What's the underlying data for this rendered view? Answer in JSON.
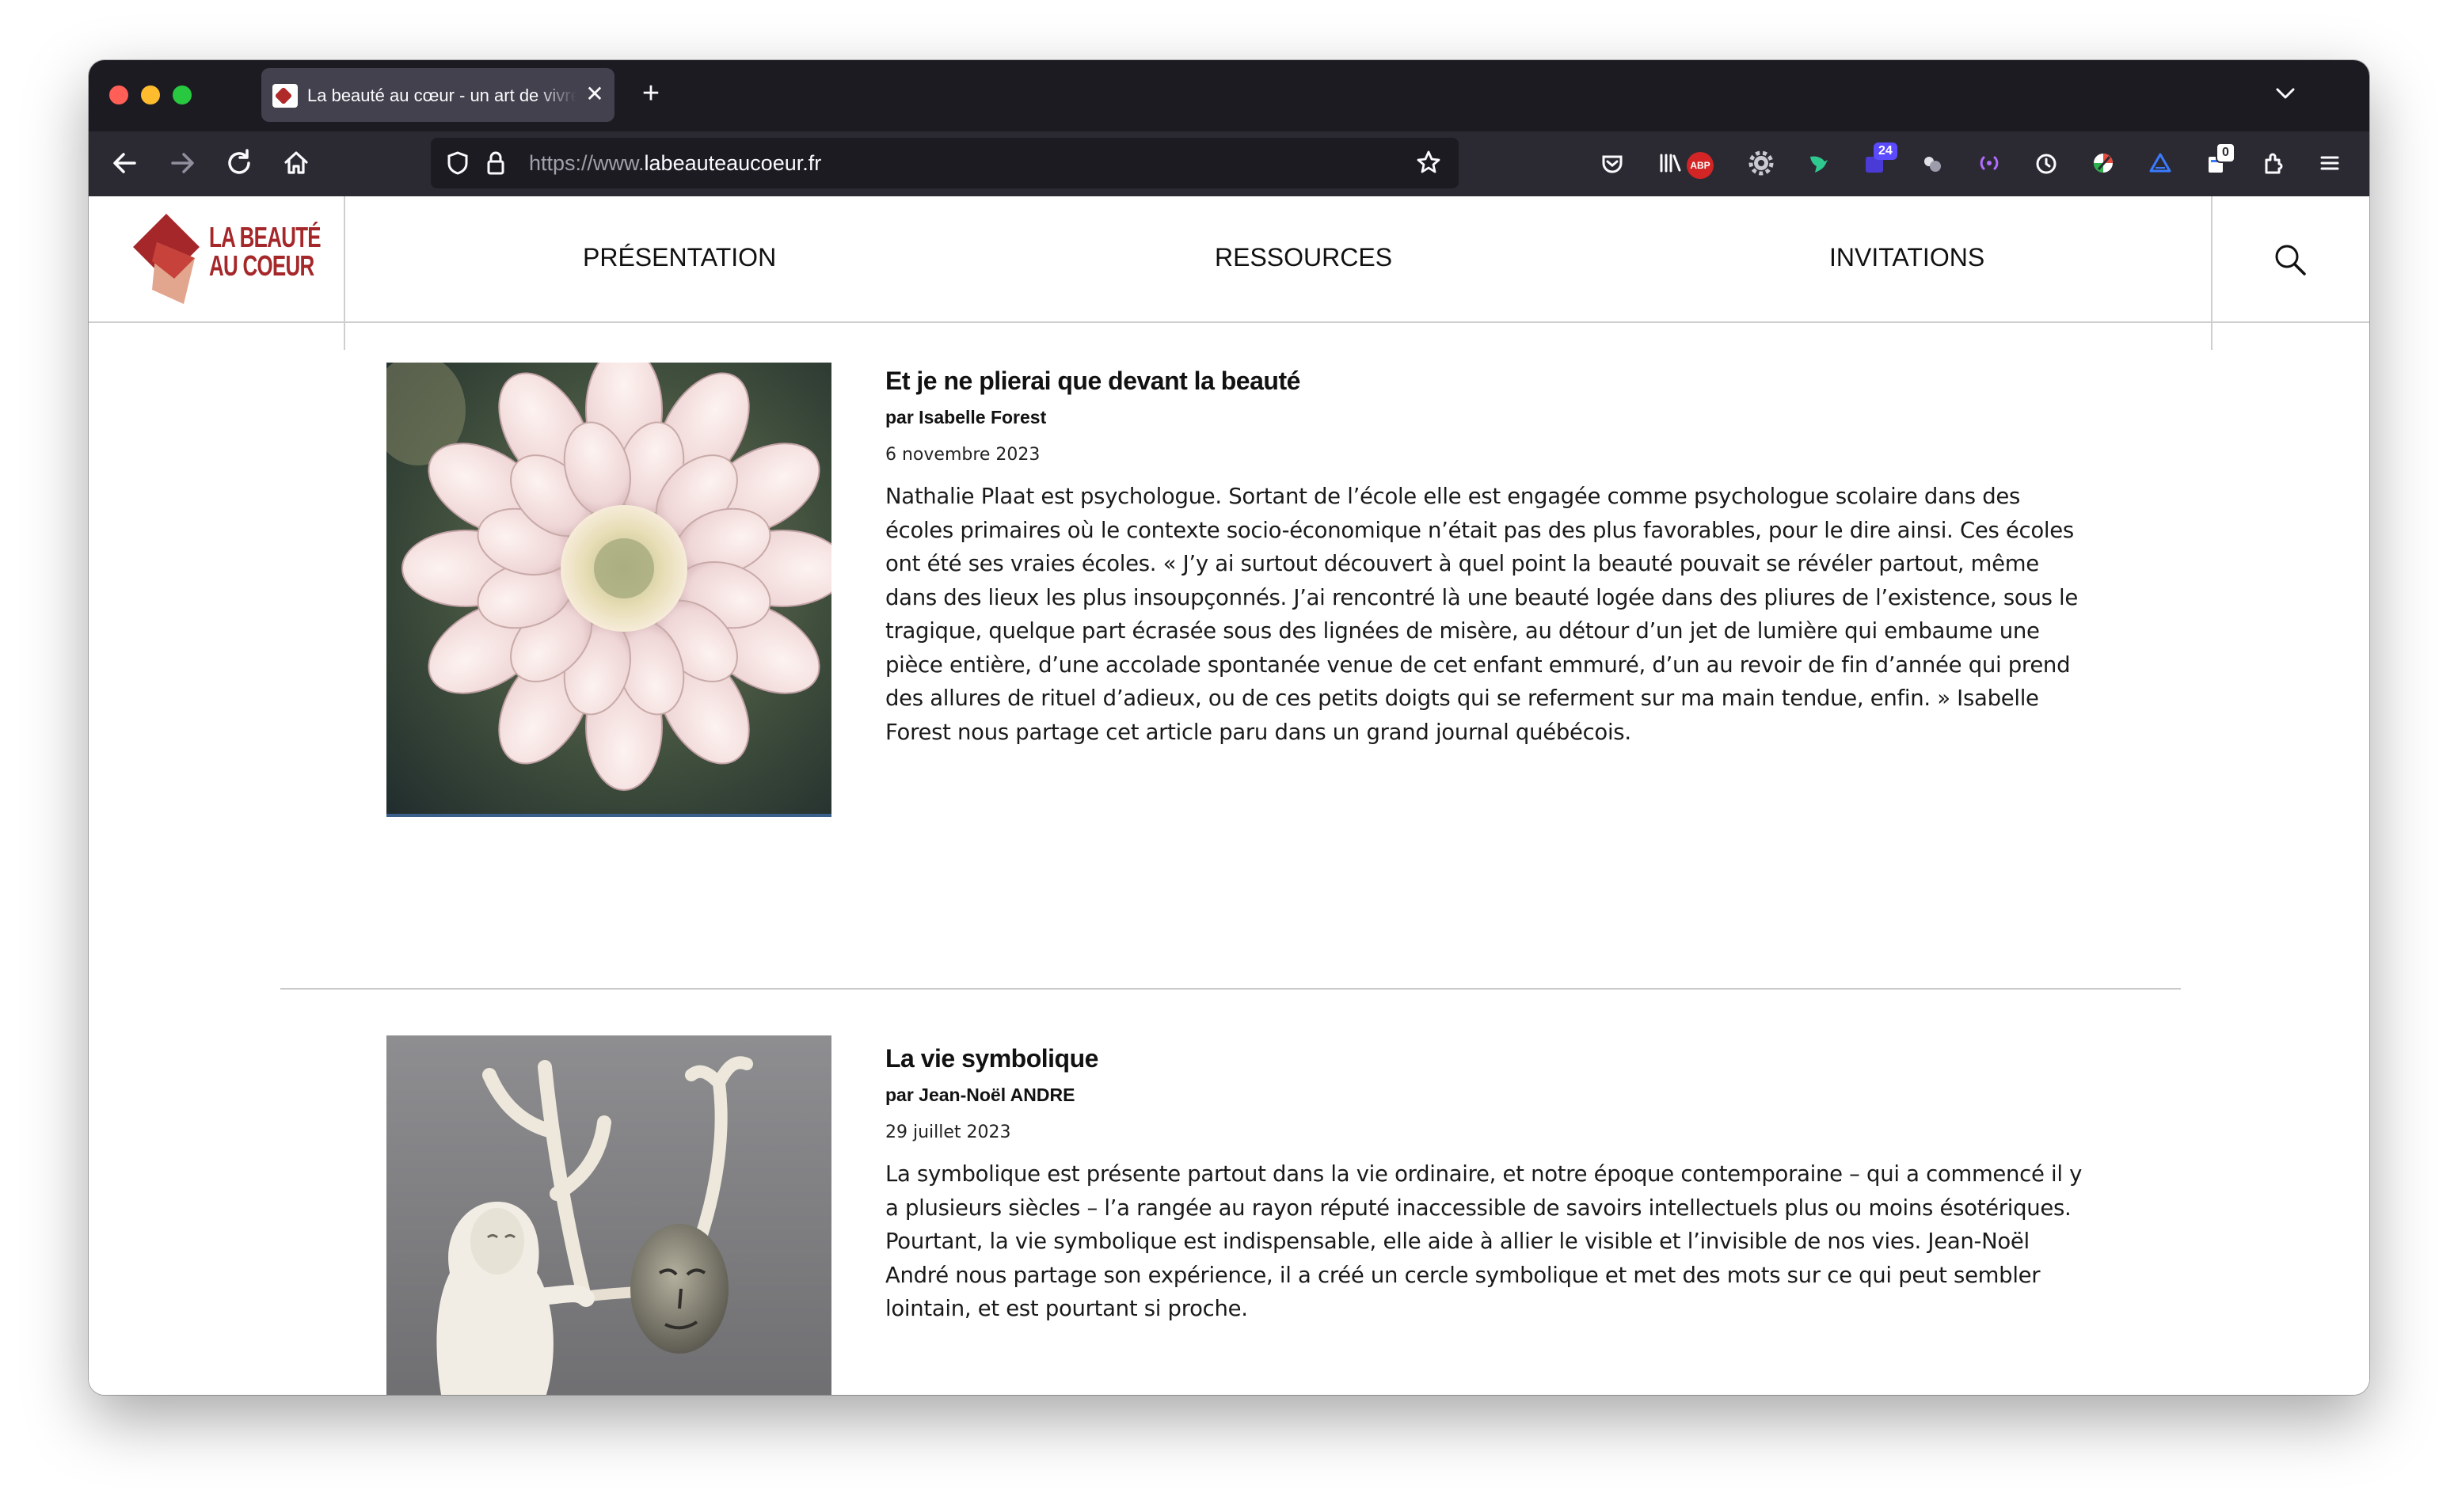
{
  "browser": {
    "tab": {
      "title": "La beauté au cœur - un art de vivre",
      "close_glyph": "✕"
    },
    "new_tab_glyph": "+",
    "tab_list_glyph": "⌄",
    "url": {
      "prefix": "https://www.",
      "domain": "labeauteaucoeur.fr"
    },
    "toolbar_icons": [
      "back-icon",
      "forward-icon",
      "reload-icon",
      "home-icon",
      "shield-icon",
      "lock-icon",
      "star-icon",
      "pocket-icon",
      "library-icon",
      "adblock-icon",
      "gear-icon",
      "bird-icon",
      "calendar-icon",
      "puzzle-icon",
      "extensions-icon",
      "menu-icon"
    ],
    "extensions": {
      "abp_label": "ABP",
      "calendar_badge": "24",
      "counter_badge": "0"
    }
  },
  "site": {
    "logo": {
      "line1": "LA BEAUTÉ",
      "line2": "AU COEUR",
      "colors": [
        "#a5272a",
        "#c7423a",
        "#e2a58e"
      ]
    },
    "menu": [
      {
        "label": "Présentation"
      },
      {
        "label": "Ressources"
      },
      {
        "label": "Invitations"
      }
    ]
  },
  "articles": [
    {
      "title": "Et je ne plierai que devant la beauté",
      "author": "par Isabelle Forest",
      "date": "6 novembre 2023",
      "excerpt": "Nathalie Plaat est psychologue. Sortant de l’école elle est engagée comme psychologue scolaire dans des écoles primaires où le contexte socio-économique n’était pas des plus favorables, pour le dire ainsi. Ces écoles ont été ses vraies écoles. « J’y ai surtout découvert à quel point la beauté pouvait se révéler partout, même dans des lieux les plus insoupçonnés. J’ai rencontré là une beauté logée dans des pliures de l’existence, sous le tragique, quelque part écrasée sous des lignées de misère, au détour d’un jet de lumière qui embaume une pièce entière, d’une accolade spontanée venue de cet enfant emmuré, d’un au revoir de fin d’année qui prend des allures de rituel d’adieux, ou de ces petits doigts qui se referment sur ma main tendue, enfin. » Isabelle Forest nous partage cet article paru dans un grand journal québécois.",
      "image": "dahlia-flower"
    },
    {
      "title": "La vie symbolique",
      "author": "par Jean-Noël ANDRE",
      "date": "29 juillet 2023",
      "excerpt": "La symbolique est présente partout dans la vie ordinaire, et notre époque contemporaine – qui a commencé il y a plusieurs siècles – l’a rangée au rayon réputé inaccessible de savoirs intellectuels plus ou moins ésotériques. Pourtant, la vie symbolique est indispensable, elle aide à allier le visible et l’invisible de nos vies. Jean-Noël André nous partage son expérience, il a créé un cercle symbolique et met des mots sur ce qui peut sembler lointain, et est pourtant si proche.",
      "image": "antler-sculpture"
    }
  ]
}
